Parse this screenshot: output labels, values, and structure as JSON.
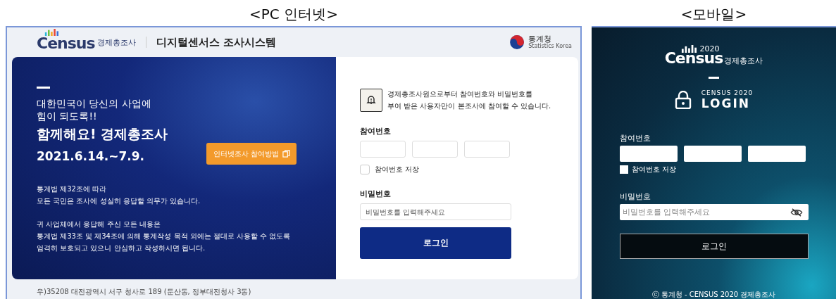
{
  "pc": {
    "caption": "<PC 인터넷>",
    "header": {
      "logo_word": "Census",
      "logo_sub": "경제총조사",
      "system_title": "디지털센서스 조사시스템",
      "agency": "통계청",
      "agency_en": "Statistics Korea"
    },
    "hero": {
      "lead": [
        "대한민국이 당신의 사업에",
        "힘이 되도록!!"
      ],
      "headline": "함께해요! 경제총조사",
      "dates": "2021.6.14.~7.9.",
      "guide_button": "인터넷조사 참여방법",
      "notices": [
        [
          "통계법 제32조에 따라",
          "모든 국민은 조사에 성실히 응답할 의무가 있습니다."
        ],
        [
          "귀 사업체에서 응답해 주신 모든 내용은",
          "통계법 제33조 및 제34조에 의해 통계작성 목적 외에는 절대로 사용할 수 없도록",
          "엄격히 보호되고 있으니 안심하고 작성하시면 됩니다."
        ]
      ]
    },
    "login": {
      "info": [
        "경제총조사원으로부터 참여번호와 비밀번호를",
        "부여 받은 사용자만이 본조사에 참여할 수 있습니다."
      ],
      "id_label": "참여번호",
      "save_label": "참여번호 저장",
      "save_checked": false,
      "pw_label": "비밀번호",
      "pw_placeholder": "비밀번호를 입력해주세요",
      "button": "로그인"
    },
    "address": "우)35208 대전광역시 서구 청사로 189 (둔산동, 정부대전청사 3동)"
  },
  "mobile": {
    "caption": "<모바일>",
    "logo_word": "Census",
    "logo_year": "2020",
    "logo_sub": "경제총조사",
    "login_sub": "CENSUS 2020",
    "login_title": "LOGIN",
    "id_label": "참여번호",
    "save_label": "참여번호 저장",
    "save_checked": false,
    "pw_label": "비밀번호",
    "pw_placeholder": "비밀번호를 입력해주세요",
    "button": "로그인",
    "footer": "ⓒ 통계청 - CENSUS 2020 경제총조사"
  }
}
